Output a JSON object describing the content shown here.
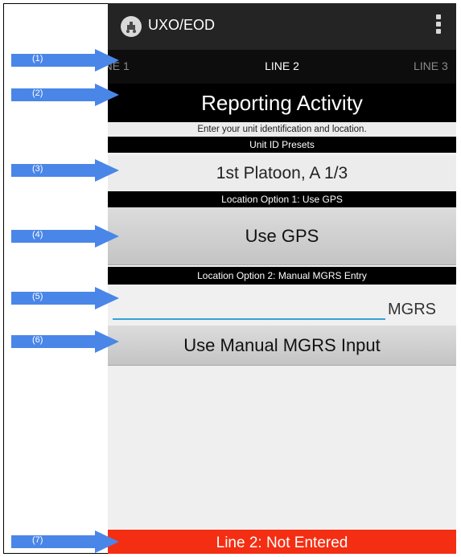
{
  "app": {
    "title": "UXO/EOD",
    "icon": "eod-robot-icon",
    "menu_icon": "overflow-menu-icon"
  },
  "tabs": [
    {
      "label": "LINE 1"
    },
    {
      "label": "LINE 2"
    },
    {
      "label": "LINE 3"
    }
  ],
  "heading": "Reporting Activity",
  "instructions": "Enter your unit identification and location.",
  "unit_presets": {
    "header": "Unit ID Presets",
    "value": "1st Platoon, A 1/3"
  },
  "location_option1": {
    "header": "Location Option 1: Use GPS",
    "button": "Use GPS"
  },
  "location_option2": {
    "header": "Location Option 2: Manual MGRS Entry",
    "input_value": "",
    "input_hint": "MGRS",
    "button": "Use Manual MGRS Input"
  },
  "status": {
    "text": "Line 2: Not Entered",
    "color": "#f42e12"
  },
  "callouts": [
    "(1)",
    "(2)",
    "(3)",
    "(4)",
    "(5)",
    "(6)",
    "(7)"
  ],
  "colors": {
    "actionbar": "#242424",
    "accent": "#33a3d6",
    "callout": "#4a86e8"
  }
}
